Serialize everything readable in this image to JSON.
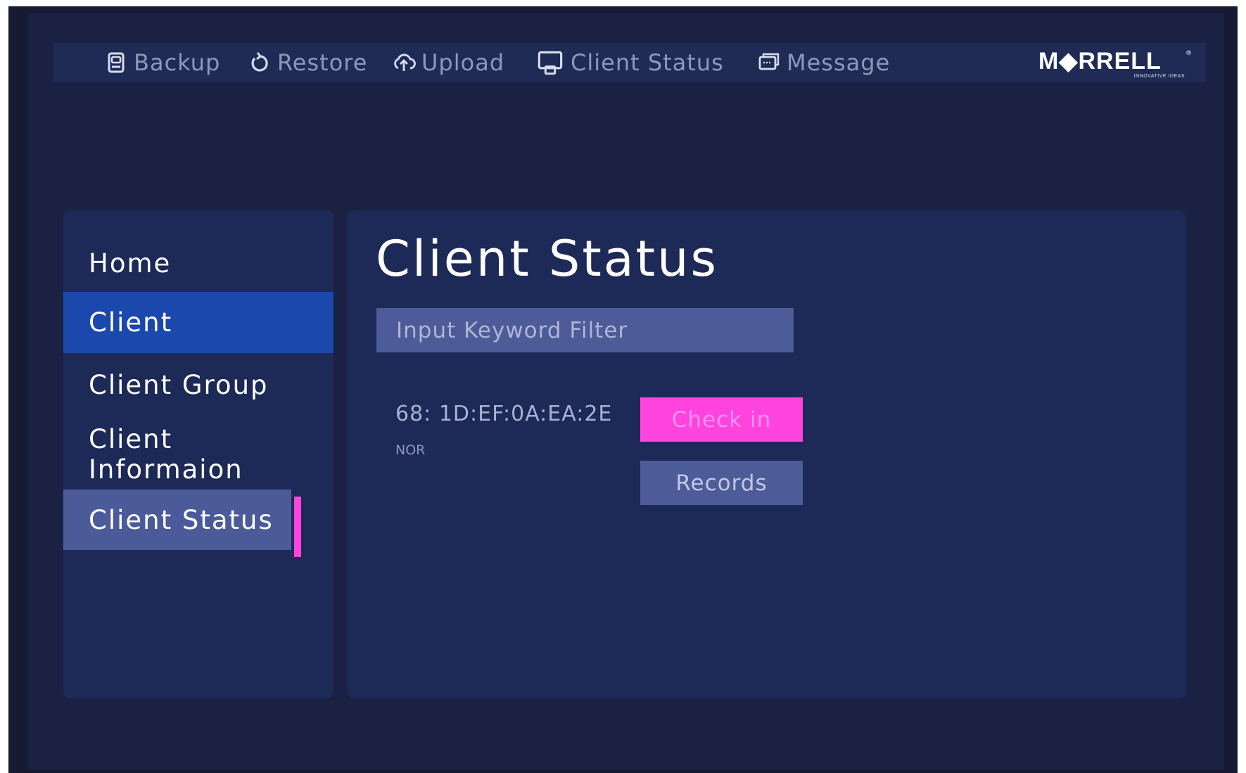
{
  "topnav": {
    "items": [
      {
        "label": "Backup",
        "icon": "backup-icon"
      },
      {
        "label": "Restore",
        "icon": "restore-icon"
      },
      {
        "label": "Upload",
        "icon": "upload-icon"
      },
      {
        "label": "Client Status",
        "icon": "monitor-icon"
      },
      {
        "label": "Message",
        "icon": "message-icon"
      }
    ],
    "logo": {
      "brand": "M◆RRELL",
      "tagline": "INNOVATIVE IDEAS",
      "reg": "®"
    }
  },
  "sidebar": {
    "items": [
      {
        "label": "Home"
      },
      {
        "label": "Client"
      },
      {
        "label": "Client Group"
      },
      {
        "label": "Client Informaion"
      },
      {
        "label": "Client Status"
      }
    ]
  },
  "main": {
    "title": "Client Status",
    "filter": {
      "placeholder": "Input Keyword Filter",
      "value": ""
    },
    "client": {
      "mac": "68: 1D:EF:0A:EA:2E",
      "mode": "NOR"
    },
    "buttons": {
      "check_in": "Check in",
      "records": "Records"
    }
  },
  "colors": {
    "background": "#1a2142",
    "panel": "#1d2957",
    "topbar": "#1f2b55",
    "active": "#1b48ad",
    "accent": "#ff44dd",
    "control": "#4d5c98"
  }
}
